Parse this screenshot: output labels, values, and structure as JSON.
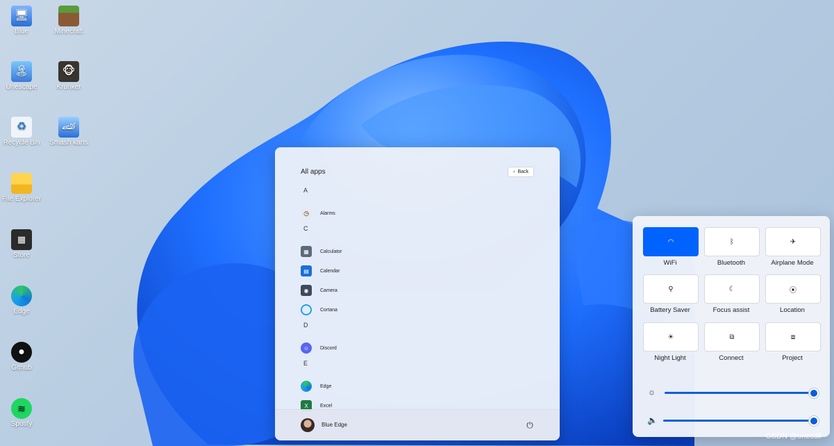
{
  "desktop": {
    "icons": [
      {
        "label": "Blue",
        "icon": "user-monitor-icon"
      },
      {
        "label": "Minecraft",
        "icon": "minecraft-icon"
      },
      {
        "label": "Unescape",
        "icon": "unescape-icon"
      },
      {
        "label": "Krunker",
        "icon": "krunker-icon"
      },
      {
        "label": "Recycle Bin",
        "icon": "recycle-bin-icon"
      },
      {
        "label": "Smash karts",
        "icon": "smash-karts-icon"
      },
      {
        "label": "File Explorer",
        "icon": "folder-icon"
      },
      {
        "label": "Store",
        "icon": "store-icon"
      },
      {
        "label": "Edge",
        "icon": "edge-icon"
      },
      {
        "label": "Github",
        "icon": "github-icon"
      },
      {
        "label": "Spotify",
        "icon": "spotify-icon"
      }
    ]
  },
  "start_menu": {
    "header": "All apps",
    "back_label": "Back",
    "sections": [
      {
        "letter": "A",
        "apps": [
          {
            "name": "Alarms",
            "icon": "alarm-clock-icon"
          }
        ]
      },
      {
        "letter": "C",
        "apps": [
          {
            "name": "Calculator",
            "icon": "calculator-icon"
          },
          {
            "name": "Calendar",
            "icon": "calendar-icon"
          },
          {
            "name": "Camera",
            "icon": "camera-icon"
          },
          {
            "name": "Cortana",
            "icon": "cortana-icon"
          }
        ]
      },
      {
        "letter": "D",
        "apps": [
          {
            "name": "Discord",
            "icon": "discord-icon"
          }
        ]
      },
      {
        "letter": "E",
        "apps": [
          {
            "name": "Edge",
            "icon": "edge-icon"
          },
          {
            "name": "Excel",
            "icon": "excel-icon"
          }
        ]
      }
    ],
    "user_name": "Blue Edge"
  },
  "quick_settings": {
    "tiles": [
      {
        "label": "WiFi",
        "icon": "wifi-icon",
        "active": true
      },
      {
        "label": "Bluetooth",
        "icon": "bluetooth-icon",
        "active": false
      },
      {
        "label": "Airplane Mode",
        "icon": "airplane-icon",
        "active": false
      },
      {
        "label": "Battery Saver",
        "icon": "battery-saver-icon",
        "active": false
      },
      {
        "label": "Focus assist",
        "icon": "moon-icon",
        "active": false
      },
      {
        "label": "Location",
        "icon": "location-icon",
        "active": false
      },
      {
        "label": "Night Light",
        "icon": "sun-icon",
        "active": false
      },
      {
        "label": "Connect",
        "icon": "connect-icon",
        "active": false
      },
      {
        "label": "Project",
        "icon": "project-icon",
        "active": false
      }
    ],
    "brightness_level": 1.0,
    "volume_level": 1.0
  },
  "watermark": "CSDN @onecdll",
  "colors": {
    "accent": "#0062ff",
    "slider": "#0a5fd8"
  }
}
